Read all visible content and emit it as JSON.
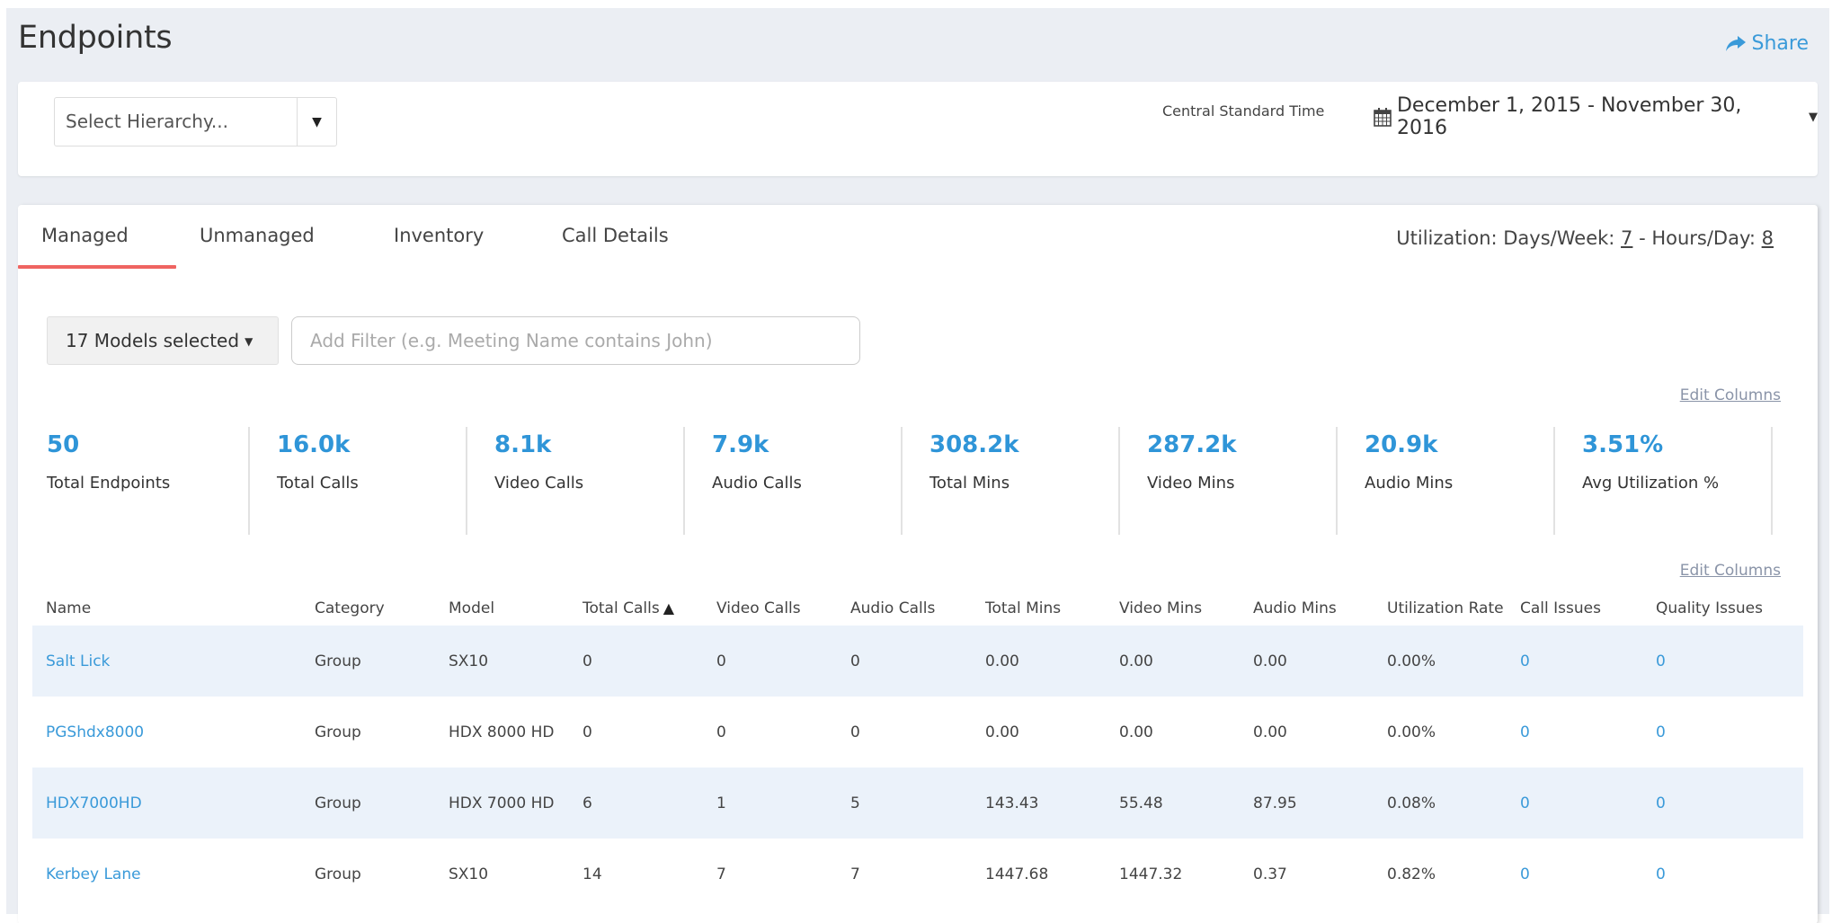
{
  "page": {
    "title": "Endpoints",
    "share_label": "Share"
  },
  "header": {
    "hierarchy_placeholder": "Select Hierarchy...",
    "timezone": "Central Standard Time",
    "date_range": "December 1, 2015 - November 30, 2016"
  },
  "tabs": [
    {
      "label": "Managed",
      "active": true
    },
    {
      "label": "Unmanaged",
      "active": false
    },
    {
      "label": "Inventory",
      "active": false
    },
    {
      "label": "Call Details",
      "active": false
    }
  ],
  "utilization": {
    "prefix": "Utilization: Days/Week: ",
    "days_per_week": "7",
    "separator": " - Hours/Day: ",
    "hours_per_day": "8"
  },
  "filters": {
    "models_label": "17 Models selected",
    "filter_placeholder": "Add Filter (e.g. Meeting Name contains John)"
  },
  "edit_columns_label": "Edit Columns",
  "stats": [
    {
      "value": "50",
      "label": "Total Endpoints"
    },
    {
      "value": "16.0k",
      "label": "Total Calls"
    },
    {
      "value": "8.1k",
      "label": "Video Calls"
    },
    {
      "value": "7.9k",
      "label": "Audio Calls"
    },
    {
      "value": "308.2k",
      "label": "Total Mins"
    },
    {
      "value": "287.2k",
      "label": "Video Mins"
    },
    {
      "value": "20.9k",
      "label": "Audio Mins"
    },
    {
      "value": "3.51%",
      "label": "Avg Utilization %"
    }
  ],
  "table": {
    "columns": [
      "Name",
      "Category",
      "Model",
      "Total Calls",
      "Video Calls",
      "Audio Calls",
      "Total Mins",
      "Video Mins",
      "Audio Mins",
      "Utilization Rate",
      "Call Issues",
      "Quality Issues"
    ],
    "sorted_column": "Total Calls",
    "sort_direction": "ascending",
    "rows": [
      [
        "Salt Lick",
        "Group",
        "SX10",
        "0",
        "0",
        "0",
        "0.00",
        "0.00",
        "0.00",
        "0.00%",
        "0",
        "0"
      ],
      [
        "PGShdx8000",
        "Group",
        "HDX 8000 HD",
        "0",
        "0",
        "0",
        "0.00",
        "0.00",
        "0.00",
        "0.00%",
        "0",
        "0"
      ],
      [
        "HDX7000HD",
        "Group",
        "HDX 7000 HD",
        "6",
        "1",
        "5",
        "143.43",
        "55.48",
        "87.95",
        "0.08%",
        "0",
        "0"
      ],
      [
        "Kerbey Lane",
        "Group",
        "SX10",
        "14",
        "7",
        "7",
        "1447.68",
        "1447.32",
        "0.37",
        "0.82%",
        "0",
        "0"
      ]
    ]
  },
  "colors": {
    "accent": "#2f95d8",
    "link": "#3a9ad9",
    "tab_underline": "#ef6461",
    "row_alt": "#ebf2fa",
    "page_bg": "#ebeef3"
  }
}
